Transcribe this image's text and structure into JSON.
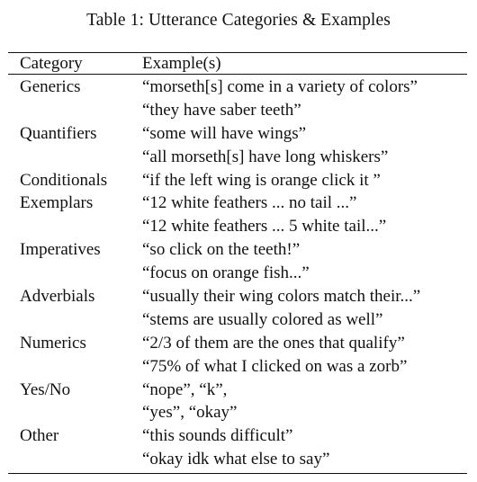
{
  "caption": "Table 1: Utterance Categories & Examples",
  "header": {
    "category": "Category",
    "examples": "Example(s)"
  },
  "rows": [
    {
      "category": "Generics",
      "example": "“morseth[s] come in a variety of colors”"
    },
    {
      "category": "",
      "example": "“they have saber teeth”"
    },
    {
      "category": "Quantifiers",
      "example": "“some will have wings”"
    },
    {
      "category": "",
      "example": "“all morseth[s] have long whiskers”"
    },
    {
      "category": "Conditionals",
      "example": "“if the left wing is orange click it ”"
    },
    {
      "category": "Exemplars",
      "example": "“12 white feathers ... no tail ...”"
    },
    {
      "category": "",
      "example": "“12 white feathers ... 5 white tail...”"
    },
    {
      "category": "Imperatives",
      "example": "“so click on the teeth!”"
    },
    {
      "category": "",
      "example": "“focus on orange fish...”"
    },
    {
      "category": "Adverbials",
      "example": "“usually their wing colors match their...”"
    },
    {
      "category": "",
      "example": "“stems are usually colored as well”"
    },
    {
      "category": "Numerics",
      "example": "“2/3 of them are the ones that qualify”"
    },
    {
      "category": "",
      "example": "“75% of what I clicked on was a zorb”"
    },
    {
      "category": "Yes/No",
      "example": "“nope”, “k”,"
    },
    {
      "category": "",
      "example": "“yes”, “okay”"
    },
    {
      "category": "Other",
      "example": "“this sounds difficult”"
    },
    {
      "category": "",
      "example": "“okay idk what else to say”"
    }
  ]
}
